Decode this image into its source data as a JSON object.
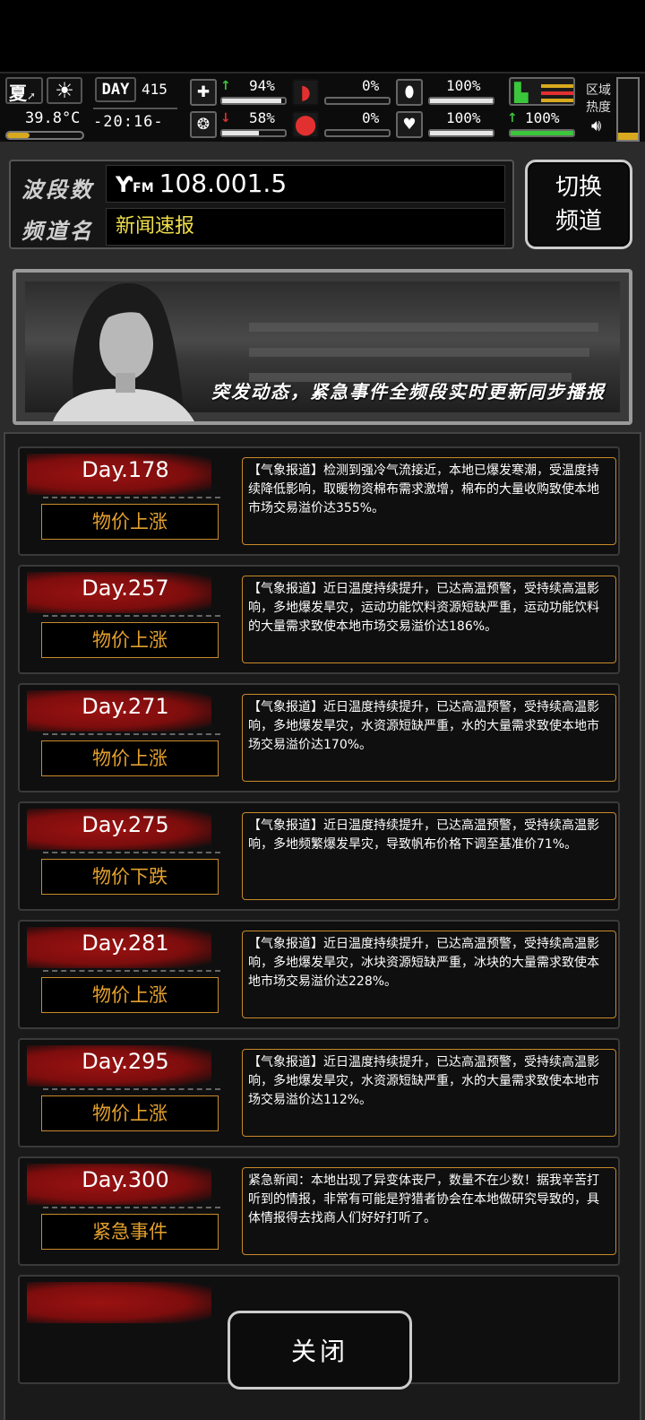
{
  "hud": {
    "season": "夏",
    "sun_icon": "sun-icon",
    "temperature": "39.8°C",
    "temp_level": 0.3,
    "day_label": "DAY",
    "day_number": "415",
    "clock": "-20:16-",
    "stats": [
      {
        "name": "health",
        "value": "94%",
        "level": 0.94,
        "trend": "up"
      },
      {
        "name": "hunger",
        "value": "0%",
        "level": 0.0
      },
      {
        "name": "pill",
        "value": "100%",
        "level": 1.0
      },
      {
        "name": "mental",
        "value": "58%",
        "level": 0.58,
        "trend": "down"
      },
      {
        "name": "thirst",
        "value": "0%",
        "level": 0.0
      },
      {
        "name": "mood",
        "value": "100%",
        "level": 1.0
      },
      {
        "name": "stamina",
        "value": "100%",
        "level": 1.0,
        "trend": "up"
      }
    ],
    "region_label": "区域\n热度",
    "colors": {
      "green": "#3cc63c",
      "red": "#e23030",
      "gold": "#d8a91e"
    }
  },
  "radio": {
    "band_label": "波段数",
    "band_value": "108.001.5",
    "channel_label": "频道名",
    "channel_value": "新闻速报",
    "switch_label": "切换\n频道"
  },
  "banner": {
    "caption": "突发动态，紧急事件全频段实时更新同步播报"
  },
  "news": [
    {
      "day": "Day.178",
      "tag": "物价上涨",
      "text": "【气象报道】检测到强冷气流接近，本地已爆发寒潮，受温度持续降低影响，取暖物资棉布需求激增，棉布的大量收购致使本地市场交易溢价达355%。"
    },
    {
      "day": "Day.257",
      "tag": "物价上涨",
      "text": "【气象报道】近日温度持续提升，已达高温预警，受持续高温影响，多地爆发旱灾，运动功能饮料资源短缺严重，运动功能饮料的大量需求致使本地市场交易溢价达186%。"
    },
    {
      "day": "Day.271",
      "tag": "物价上涨",
      "text": "【气象报道】近日温度持续提升，已达高温预警，受持续高温影响，多地爆发旱灾，水资源短缺严重，水的大量需求致使本地市场交易溢价达170%。"
    },
    {
      "day": "Day.275",
      "tag": "物价下跌",
      "text": "【气象报道】近日温度持续提升，已达高温预警，受持续高温影响，多地频繁爆发旱灾，导致帆布价格下调至基准价71%。"
    },
    {
      "day": "Day.281",
      "tag": "物价上涨",
      "text": "【气象报道】近日温度持续提升，已达高温预警，受持续高温影响，多地爆发旱灾，冰块资源短缺严重，冰块的大量需求致使本地市场交易溢价达228%。"
    },
    {
      "day": "Day.295",
      "tag": "物价上涨",
      "text": "【气象报道】近日温度持续提升，已达高温预警，受持续高温影响，多地爆发旱灾，水资源短缺严重，水的大量需求致使本地市场交易溢价达112%。"
    },
    {
      "day": "Day.300",
      "tag": "紧急事件",
      "text": "紧急新闻：本地出现了异变体丧尸，数量不在少数！据我辛苦打听到的情报，非常有可能是狩猎者协会在本地做研究导致的，具体情报得去找商人们好好打听了。"
    }
  ],
  "close_label": "关闭"
}
